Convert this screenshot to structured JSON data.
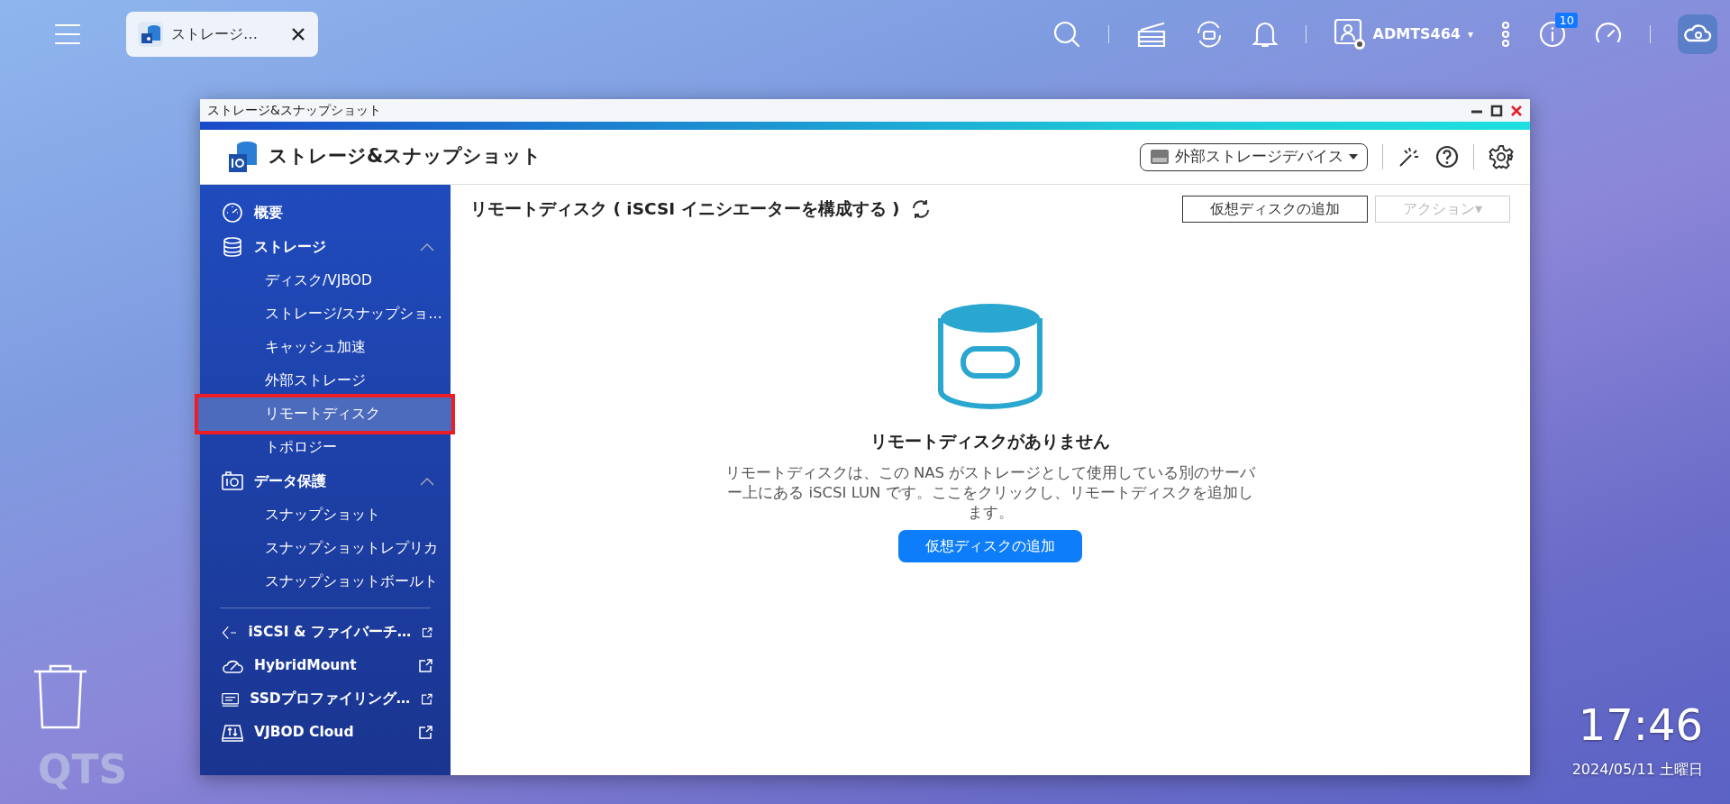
{
  "taskbar": {
    "tab": {
      "label": "ストレージ…",
      "selected": true
    },
    "user": "ADMTS464",
    "caret": "▾",
    "notification_count": "10"
  },
  "window": {
    "title": "ストレージ&スナップショット",
    "app_title": "ストレージ&スナップショット",
    "device_menu": "外部ストレージデバイス"
  },
  "sidebar": {
    "groups": [
      {
        "label": "概要"
      },
      {
        "label": "ストレージ",
        "expanded": true,
        "children": [
          {
            "label": "ディスク/VJBOD",
            "selected": false
          },
          {
            "label": "ストレージ/スナップショ…",
            "selected": false
          },
          {
            "label": "キャッシュ加速",
            "selected": false
          },
          {
            "label": "外部ストレージ",
            "selected": false
          },
          {
            "label": "リモートディスク",
            "selected": true
          },
          {
            "label": "トポロジー",
            "selected": false
          }
        ]
      },
      {
        "label": "データ保護",
        "expanded": true,
        "children": [
          {
            "label": "スナップショット",
            "selected": false
          },
          {
            "label": "スナップショットレプリカ",
            "selected": false
          },
          {
            "label": "スナップショットボールト",
            "selected": false
          }
        ]
      }
    ],
    "external": [
      {
        "label": "iSCSI & ファイバーチ…"
      },
      {
        "label": "HybridMount"
      },
      {
        "label": "SSDプロファイリング…"
      },
      {
        "label": "VJBOD Cloud"
      }
    ]
  },
  "content": {
    "title": "リモートディスク ( iSCSI イニシエーターを構成する )",
    "buttons": [
      {
        "label": "仮想ディスクの追加",
        "disabled": false
      },
      {
        "label": "アクション▾",
        "disabled": true
      }
    ],
    "empty_title": "リモートディスクがありません",
    "empty_text": "リモートディスクは、この NAS がストレージとして使用している別のサーバー上にある iSCSI LUN です。ここをクリックし、リモートディスクを追加します。",
    "empty_button": "仮想ディスクの追加"
  },
  "desktop": {
    "logo": "QTS",
    "time": "17:46",
    "date": "2024/05/11 土曜日"
  }
}
